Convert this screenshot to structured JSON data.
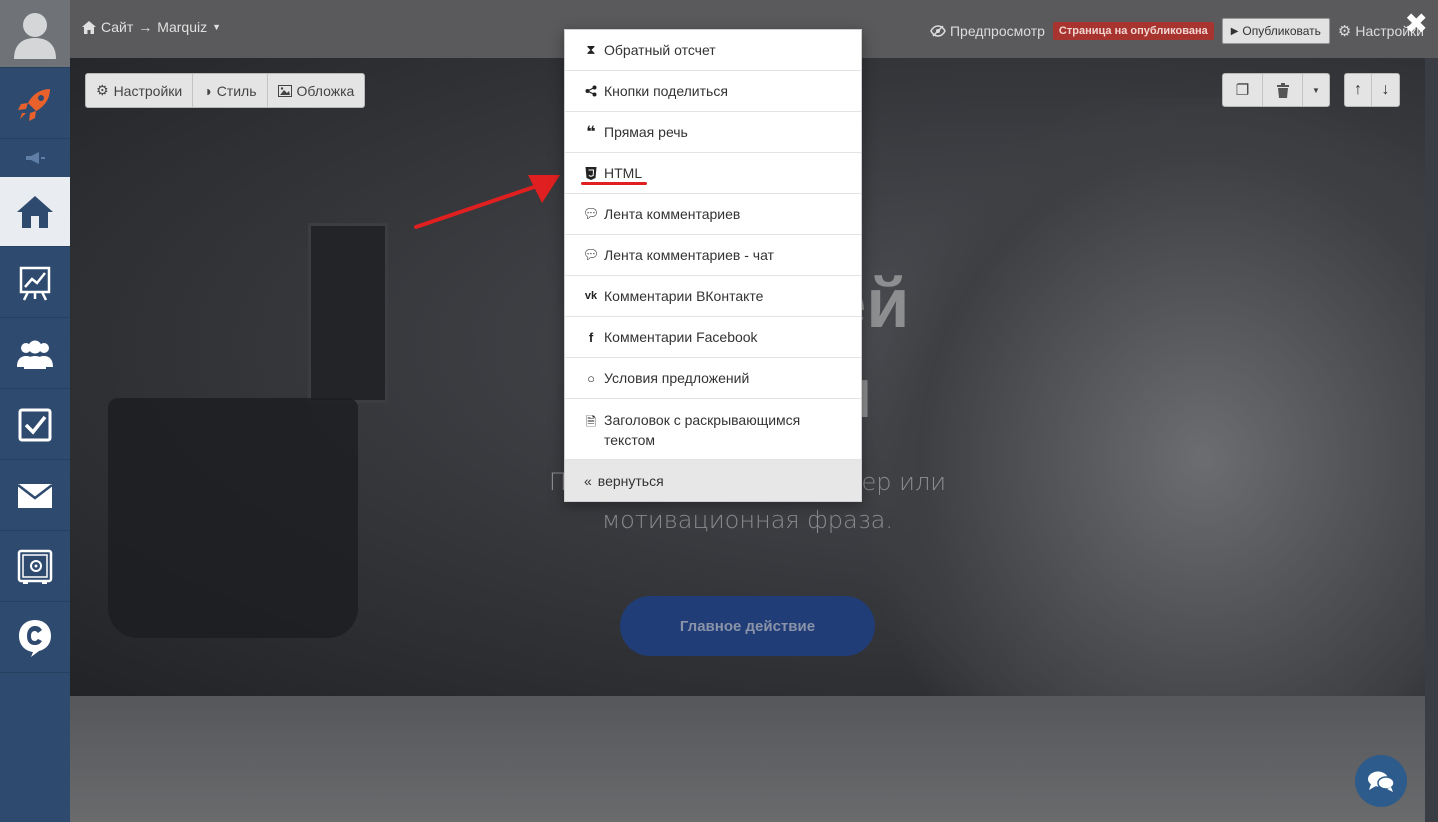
{
  "breadcrumb": {
    "root": "Сайт",
    "separator": "→",
    "current": "Marquiz"
  },
  "topbar": {
    "preview_label": "Предпросмотр",
    "status_badge": "Страница на опубликована",
    "publish_label": "Опубликовать",
    "settings_label": "Настройки"
  },
  "block_toolbar": {
    "settings_label": "Настройки",
    "style_label": "Стиль",
    "cover_label": "Обложка"
  },
  "hero": {
    "title_line1": "Наз ашей",
    "title_line2": "он олы",
    "subtitle_line1": "Пара предло льный оффер или",
    "subtitle_line2": "мотивационная фраза.",
    "cta_label": "Главное действие"
  },
  "dropdown": {
    "items": [
      {
        "label": "Обратный отсчет",
        "icon": "hourglass-icon"
      },
      {
        "label": "Кнопки поделиться",
        "icon": "share-icon"
      },
      {
        "label": "Прямая речь",
        "icon": "quote-icon"
      },
      {
        "label": "HTML",
        "icon": "html5-icon"
      },
      {
        "label": "Лента комментариев",
        "icon": "comments-icon"
      },
      {
        "label": "Лента комментариев - чат",
        "icon": "comments-icon"
      },
      {
        "label": "Комментарии ВКонтакте",
        "icon": "vk-icon"
      },
      {
        "label": "Комментарии Facebook",
        "icon": "facebook-icon"
      },
      {
        "label": "Условия предложений",
        "icon": "circle-icon"
      },
      {
        "label": "Заголовок с раскрывающимся текстом",
        "icon": "file-text-icon"
      }
    ],
    "back_label": "вернуться"
  },
  "colors": {
    "sidebar": "#2e4a6e",
    "accent_rocket": "#e8612c",
    "status_badge": "#a8342f",
    "cta": "#213d77",
    "annotation": "#e02020"
  }
}
